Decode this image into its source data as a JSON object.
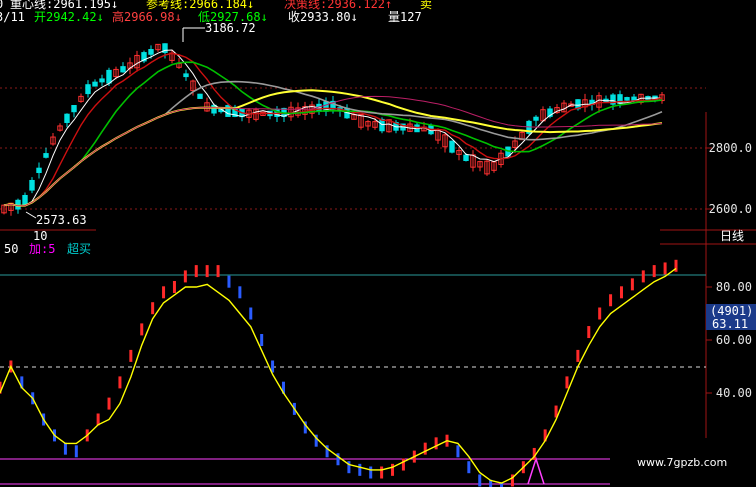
{
  "header": {
    "row1": [
      {
        "text": "0",
        "color": "#ffffff"
      },
      {
        "text": "重心线:2961.195↓",
        "color": "#ffffff"
      },
      {
        "text": "参考线:2966.184↓",
        "color": "#ffff00"
      },
      {
        "text": "决策线:2936.122↑",
        "color": "#ff3333"
      },
      {
        "text": "卖",
        "color": "#ffff00"
      }
    ],
    "row2": [
      {
        "text": "3/11",
        "color": "#ffffff"
      },
      {
        "text": "开2942.42↓",
        "color": "#00ff00"
      },
      {
        "text": "高2966.98↓",
        "color": "#ff4040"
      },
      {
        "text": "低2927.68↓",
        "color": "#00ff00"
      },
      {
        "text": "收2933.80↓",
        "color": "#ffffff"
      },
      {
        "text": "量127",
        "color": "#ffffff"
      }
    ]
  },
  "annotations": {
    "high": "3186.72",
    "low": "2573.63",
    "period": "10"
  },
  "indicator_labels": [
    {
      "text": "50",
      "color": "#ffffff"
    },
    {
      "text": "加:5",
      "color": "#ff00ff"
    },
    {
      "text": "超买",
      "color": "#00cccc"
    }
  ],
  "right_axis": {
    "price_ticks": [
      "2800.0",
      "2600.0"
    ],
    "period_label": "日线",
    "indicator_ticks": [
      "80.00",
      "60.00",
      "40.00"
    ],
    "badge_code": "(4901)",
    "badge_value": "63.11"
  },
  "watermark": "www.7gpzb.com",
  "colors": {
    "background": "#000000",
    "up": "#ff3030",
    "down": "#00e0e0",
    "ma_white": "#ffffff",
    "ma_yellow": "#ffff33",
    "ma_green": "#00c000",
    "ma_gray": "#9a9a9a",
    "ma_red": "#cc1010",
    "ma_magenta": "#bb1f66",
    "kd_line": "#ffff00",
    "kd_up": "#ff2a2a",
    "kd_down": "#2a5cff",
    "overbought_line": "#2a9a9a",
    "grid_red": "#8a1a1a",
    "signal": "#ff40ff"
  },
  "chart_data": {
    "type": "candlestick",
    "price_axis_ticks": [
      2800.0,
      2600.0
    ],
    "price_high_marker": 3186.72,
    "price_low_marker": 2573.63,
    "last_bar": {
      "open": 2942.42,
      "high": 2966.98,
      "low": 2927.68,
      "close": 2933.8
    },
    "lines": {
      "center_line": 2961.195,
      "reference_line": 2966.184,
      "decision_line": 2936.122
    },
    "indicator": {
      "ticks": [
        80.0,
        60.0,
        40.0
      ],
      "overbought": 85,
      "midline": 50,
      "current_value": 63.11,
      "kd_line": [
        40,
        50,
        42,
        38,
        30,
        24,
        21,
        21,
        24,
        28,
        30,
        36,
        46,
        58,
        68,
        74,
        77,
        80,
        80,
        81,
        78,
        75,
        70,
        65,
        56,
        47,
        40,
        34,
        28,
        23,
        19,
        16,
        13,
        12,
        11,
        11,
        12,
        14,
        16,
        18,
        20,
        22,
        21,
        16,
        10,
        7,
        6,
        8,
        12,
        16,
        22,
        30,
        40,
        50,
        58,
        65,
        70,
        73,
        76,
        79,
        82,
        84,
        87
      ],
      "bars": [
        42,
        50,
        44,
        38,
        30,
        24,
        19,
        18,
        24,
        30,
        36,
        44,
        54,
        64,
        72,
        78,
        80,
        84,
        86,
        86,
        86,
        82,
        78,
        70,
        60,
        50,
        42,
        34,
        27,
        22,
        18,
        15,
        12,
        11,
        10,
        10,
        11,
        13,
        16,
        19,
        21,
        22,
        18,
        12,
        7,
        5,
        4,
        7,
        12,
        17,
        24,
        33,
        44,
        54,
        63,
        70,
        75,
        78,
        81,
        84,
        86,
        87,
        88
      ]
    }
  }
}
